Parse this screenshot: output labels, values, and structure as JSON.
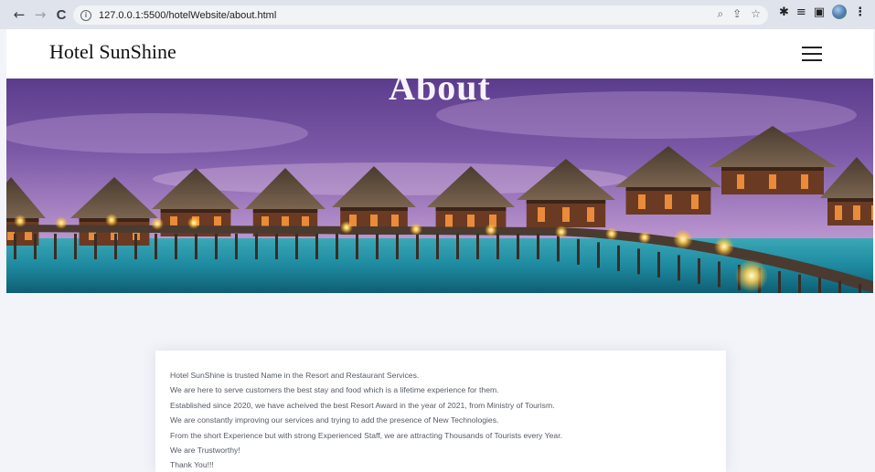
{
  "browser": {
    "url": "127.0.0.1:5500/hotelWebsite/about.html",
    "back_icon": "←",
    "forward_icon": "→",
    "reload_icon": "C",
    "info_icon": "i",
    "zoom_icon": "⌕",
    "share_icon": "⇪",
    "bookmark_icon": "☆",
    "extensions_icon": "✱",
    "reading_list_icon": "≡",
    "side_panel_icon": "▣",
    "menu_icon": "⋮"
  },
  "site": {
    "brand": "Hotel SunShine",
    "menu_icon": "hamburger-icon"
  },
  "hero": {
    "title": "About",
    "colors": {
      "sky_top": "#5b3c8c",
      "sky_bottom": "#c7a0d6",
      "water": "#1f8fa3"
    }
  },
  "about": {
    "lines": [
      "Hotel SunShine is trusted Name in the Resort and Restaurant Services.",
      "We are here to serve customers the best stay and food which is a lifetime experience for them.",
      "Established since 2020, we have acheived the best Resort Award in the year of 2021, from Ministry of Tourism.",
      "We are constantly improving our services and trying to add the presence of New Technologies.",
      "From the short Experience but with strong Experienced Staff, we are attracting Thousands of Tourists every Year.",
      "We are Trustworthy!",
      "Thank You!!!"
    ]
  }
}
